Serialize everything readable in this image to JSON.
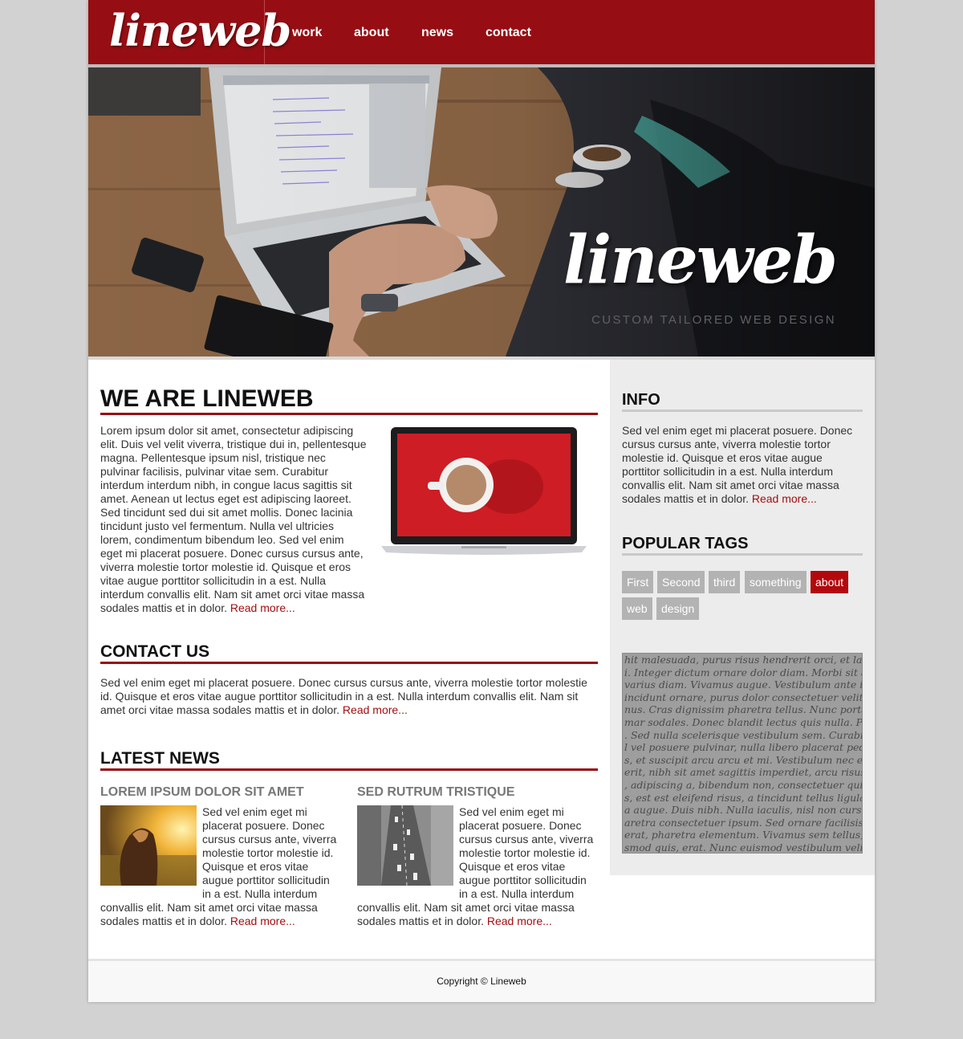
{
  "header": {
    "logo_text": "lineweb",
    "nav": [
      "work",
      "about",
      "news",
      "contact"
    ]
  },
  "hero": {
    "brand": "lineweb",
    "tagline": "CUSTOM TAILORED WEB DESIGN"
  },
  "about": {
    "title": "WE ARE LINEWEB",
    "text": "Lorem ipsum dolor sit amet, consectetur adipiscing elit. Duis vel velit viverra, tristique dui in, pellentesque magna. Pellentesque ipsum nisl, tristique nec pulvinar facilisis, pulvinar vitae sem. Curabitur interdum interdum nibh, in congue lacus sagittis sit amet. Aenean ut lectus eget est adipiscing laoreet. Sed tincidunt sed dui sit amet mollis. Donec lacinia tincidunt justo vel fermentum. Nulla vel ultricies lorem, condimentum bibendum leo. Sed vel enim eget mi placerat posuere. Donec cursus cursus ante, viverra molestie tortor molestie id. Quisque et eros vitae augue porttitor sollicitudin in a est. Nulla interdum convallis elit. Nam sit amet orci vitae massa sodales mattis et in dolor.",
    "read_more": "Read more..."
  },
  "contact": {
    "title": "CONTACT US",
    "text": "Sed vel enim eget mi placerat posuere. Donec cursus cursus ante, viverra molestie tortor molestie id. Quisque et eros vitae augue porttitor sollicitudin in a est. Nulla interdum convallis elit. Nam sit amet orci vitae massa sodales mattis et in dolor.",
    "read_more": "Read more..."
  },
  "news": {
    "title": "LATEST NEWS",
    "items": [
      {
        "title": "LOREM IPSUM DOLOR SIT AMET",
        "text": "Sed vel enim eget mi placerat posuere. Donec cursus cursus ante, viverra molestie tortor molestie id. Quisque et eros vitae augue porttitor sollicitudin in a est. Nulla interdum convallis elit. Nam sit amet orci vitae massa sodales mattis et in dolor.",
        "read_more": "Read more..."
      },
      {
        "title": "SED RUTRUM TRISTIQUE",
        "text": "Sed vel enim eget mi placerat posuere. Donec cursus cursus ante, viverra molestie tortor molestie id. Quisque et eros vitae augue porttitor sollicitudin in a est. Nulla interdum convallis elit. Nam sit amet orci vitae massa sodales mattis et in dolor.",
        "read_more": "Read more..."
      }
    ]
  },
  "sidebar": {
    "info_title": "INFO",
    "info_text": "Sed vel enim eget mi placerat posuere. Donec cursus cursus ante, viverra molestie tortor molestie id. Quisque et eros vitae augue porttitor sollicitudin in a est. Nulla interdum convallis elit. Nam sit amet orci vitae massa sodales mattis et in dolor.",
    "read_more": "Read more...",
    "tags_title": "POPULAR TAGS",
    "tags": [
      "First",
      "Second",
      "third",
      "something",
      "about",
      "web",
      "design"
    ],
    "active_tag": "about",
    "script_lines": [
      "hit malesuada, purus risus hendrerit orci, et laoreet pede mi",
      "i. Integer dictum ornare dolor diam. Morbi sit amet arcu n",
      "varius diam. Vivamus augue. Vestibulum ante ipsum pedi",
      "incidunt ornare, purus dolor consectetuer velit, in euismod",
      "nus. Cras dignissim pharetra tellus. Nunc porta commodo",
      "mar sodales. Donec blandit lectus quis nulla. Phasellus du",
      ". Sed nulla scelerisque vestibulum sem. Curabitur libero n",
      "l vel posuere pulvinar, nulla libero placerat pede, at com",
      "s, et suscipit arcu arcu et mi. Vestibulum nec eros dictum",
      "erit, nibh sit amet sagittis imperdiet, arcu risus dignissim",
      ", adipiscing a, bibendum non, consectetuer quis, sem. Proin",
      "s, est est eleifend risus, a tincidunt tellus ligula et lectus.",
      "a augue. Duis nibh. Nulla iaculis, nisl non cursus iaculis, p",
      "aretra consectetuer ipsum. Sed ornare facilisis odio. Cum s",
      "erat, pharetra elementum. Vivamus sem tellus, dignissim",
      "smod quis, erat. Nunc euismod vestibulum velit. Proin urn"
    ]
  },
  "footer": {
    "copyright": "Copyright © Lineweb"
  },
  "colors": {
    "brand": "#960e13",
    "accent_link": "#a20e10",
    "tag_bg": "#b3b3b3",
    "tag_active_bg": "#b3090c",
    "sidebar_bg": "#ececec",
    "page_bg": "#d2d2d2"
  }
}
